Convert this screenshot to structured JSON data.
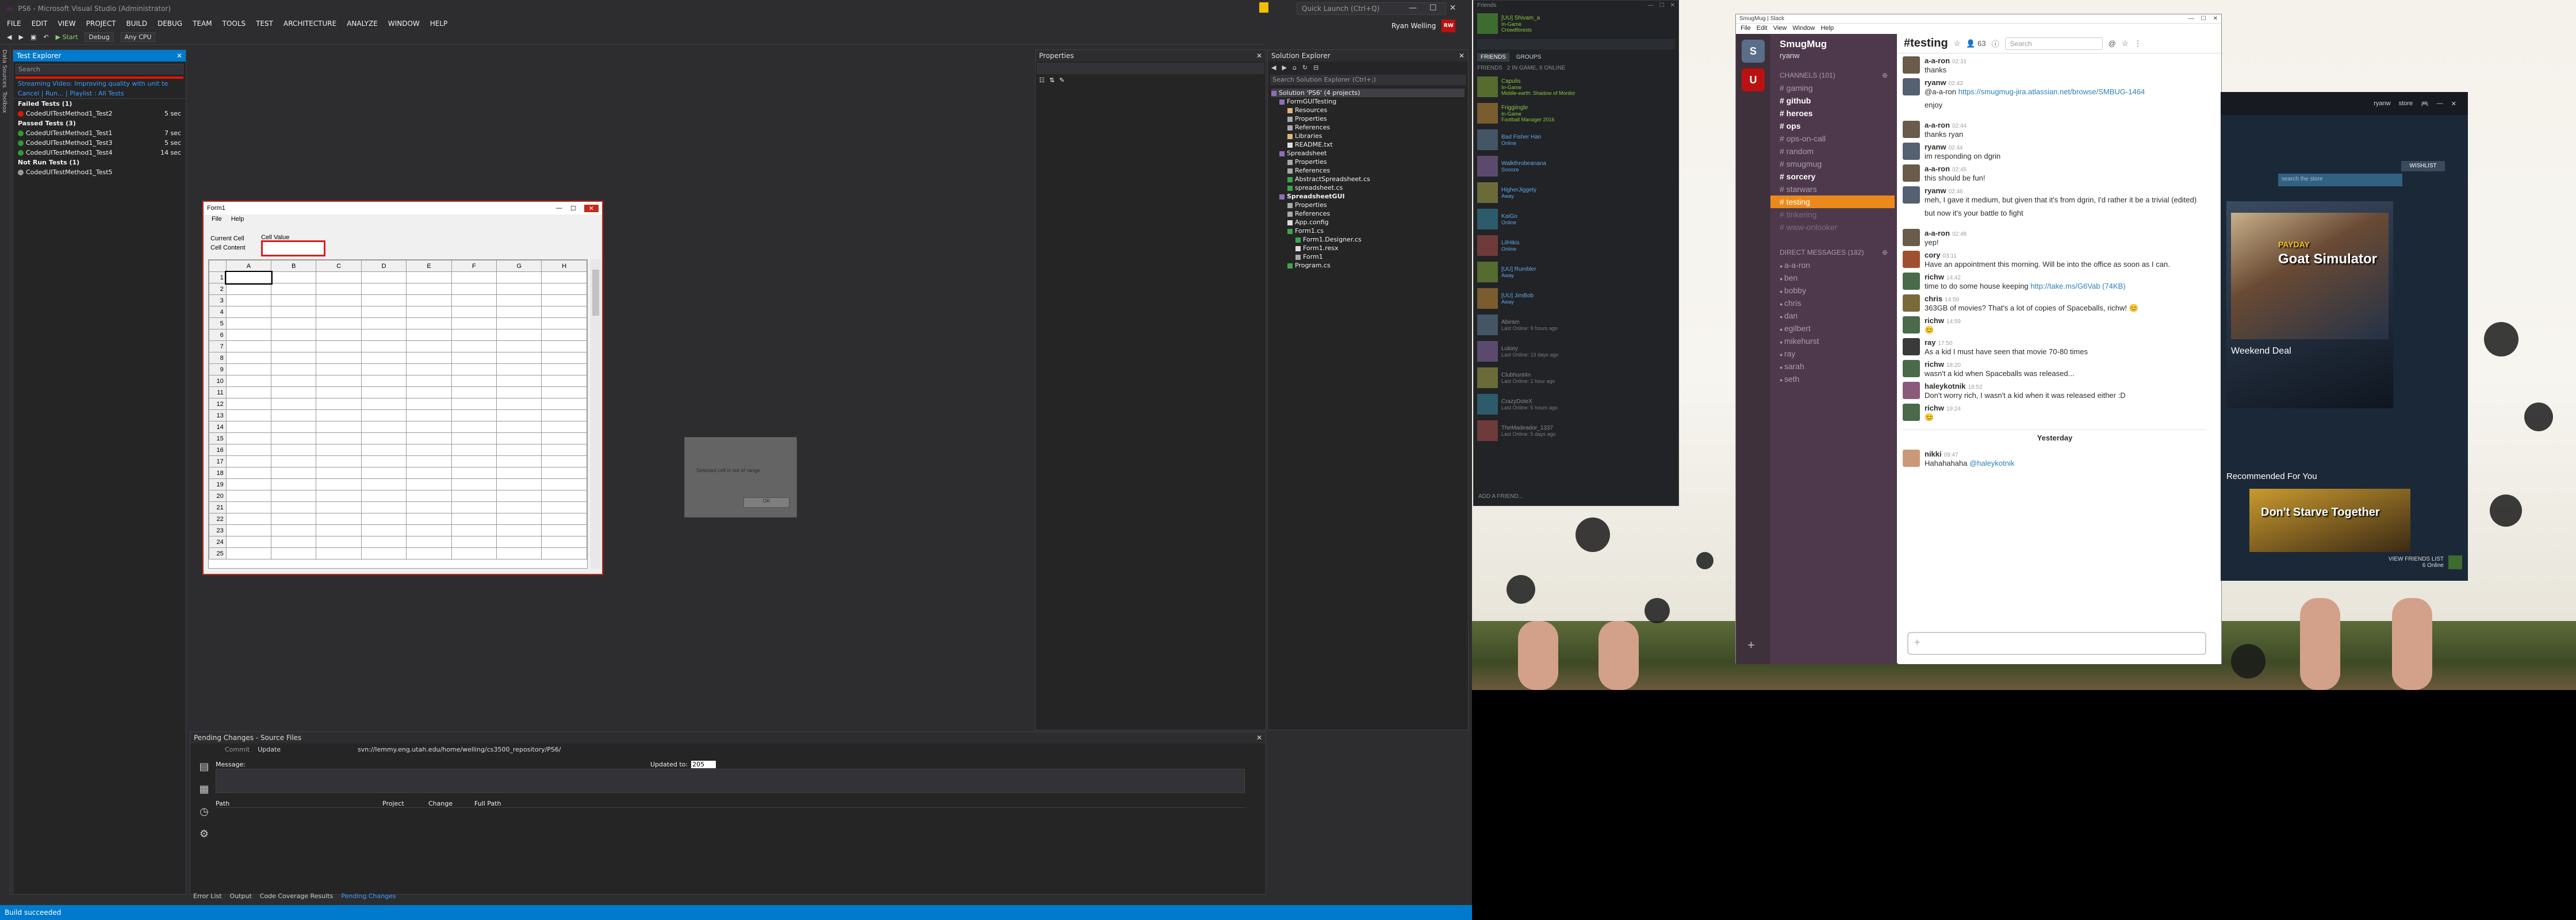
{
  "vs": {
    "title": "PS6 - Microsoft Visual Studio (Administrator)",
    "quick_launch": "Quick Launch (Ctrl+Q)",
    "user": "Ryan Welling",
    "user_initials": "RW",
    "menu": [
      "FILE",
      "EDIT",
      "VIEW",
      "PROJECT",
      "BUILD",
      "DEBUG",
      "TEAM",
      "TOOLS",
      "TEST",
      "ARCHITECTURE",
      "ANALYZE",
      "WINDOW",
      "HELP"
    ],
    "toolbar": {
      "start": "Start",
      "config": "Debug",
      "platform": "Any CPU"
    },
    "left_strip": [
      "Data Sources",
      "Toolbox"
    ],
    "test_explorer": {
      "title": "Test Explorer",
      "search": "Search",
      "warning": "Streaming Video: Improving quality with unit te",
      "links": "Cancel | Run... | Playlist : All Tests",
      "groups": [
        {
          "label": "Failed Tests (1)",
          "color": "#e51400",
          "tests": [
            {
              "name": "CodedUITestMethod1_Test2",
              "time": "5 sec"
            }
          ]
        },
        {
          "label": "Passed Tests (3)",
          "color": "#339933",
          "tests": [
            {
              "name": "CodedUITestMethod1_Test1",
              "time": "7 sec"
            },
            {
              "name": "CodedUITestMethod1_Test3",
              "time": "5 sec"
            },
            {
              "name": "CodedUITestMethod1_Test4",
              "time": "14 sec"
            }
          ]
        },
        {
          "label": "Not Run Tests (1)",
          "color": "#999999",
          "tests": [
            {
              "name": "CodedUITestMethod1_Test5",
              "time": ""
            }
          ]
        }
      ]
    },
    "form": {
      "title": "Form1",
      "menu": [
        "File",
        "Help"
      ],
      "current_cell_label": "Current Cell",
      "cell_value_label": "Cell Value",
      "cell_content_label": "Cell Content",
      "columns": [
        "A",
        "B",
        "C",
        "D",
        "E",
        "F",
        "G",
        "H"
      ],
      "rows": [
        "1",
        "2",
        "3",
        "4",
        "5",
        "6",
        "7",
        "8",
        "9",
        "10",
        "11",
        "12",
        "13",
        "14",
        "15",
        "16",
        "17",
        "18",
        "19",
        "20",
        "21",
        "22",
        "23",
        "24",
        "25"
      ]
    },
    "ghost_dialog": {
      "text": "Selected cell is out of range.",
      "button": "OK"
    },
    "properties": {
      "title": "Properties"
    },
    "solution_explorer": {
      "title": "Solution Explorer",
      "search": "Search Solution Explorer (Ctrl+;)",
      "items": [
        "Solution 'PS6' (4 projects)",
        "FormGUITesting",
        "Resources",
        "Properties",
        "References",
        "Libraries",
        "README.txt",
        "Spreadsheet",
        "Properties",
        "References",
        "AbstractSpreadsheet.cs",
        "spreadsheet.cs",
        "SpreadsheetGUI",
        "Properties",
        "References",
        "App.config",
        "Form1.cs",
        "Form1.Designer.cs",
        "Form1.resx",
        "Form1",
        "Program.cs"
      ]
    },
    "pending": {
      "title": "Pending Changes - Source Files",
      "actions": [
        "Commit",
        "Update"
      ],
      "path": "svn://lemmy.eng.utah.edu/home/welling/cs3500_repository/PS6/",
      "message_label": "Message:",
      "updated_label": "Updated to:",
      "updated_value": "205",
      "columns": [
        "Path",
        "Project",
        "Change",
        "Full Path"
      ],
      "tabs": [
        "Error List",
        "Output",
        "Code Coverage Results",
        "Pending Changes"
      ]
    },
    "status": "Build succeeded"
  },
  "steam": {
    "header": "Friends",
    "me": {
      "name": "[UU] Shivam_a",
      "status": "In-Game",
      "game": "Crowdforests"
    },
    "tabs": [
      "FRIENDS",
      "GROUPS"
    ],
    "section": "FRIENDS",
    "online": "2 IN GAME, 6 ONLINE",
    "friends": [
      {
        "name": "Capulis",
        "status": "In-Game",
        "sub": "Middle-earth: Shadow of Mordor",
        "state": "ingame"
      },
      {
        "name": "Friggiingle",
        "status": "In-Game",
        "sub": "Football Manager 2016",
        "state": "ingame"
      },
      {
        "name": "Bad Fisher Han",
        "status": "Online",
        "sub": "",
        "state": "online"
      },
      {
        "name": "Walkthrobeanana",
        "status": "Snooze",
        "sub": "",
        "state": "online"
      },
      {
        "name": "HigherJiggety",
        "status": "Away",
        "sub": "",
        "state": "online"
      },
      {
        "name": "KaiGo",
        "status": "Online",
        "sub": "",
        "state": "online"
      },
      {
        "name": "LilHikis",
        "status": "Online",
        "sub": "",
        "state": "online"
      },
      {
        "name": "[UU] Rumbler",
        "status": "Away",
        "sub": "",
        "state": "online"
      },
      {
        "name": "[UU] JimBob",
        "status": "Away",
        "sub": "",
        "state": "online"
      },
      {
        "name": "Abiram",
        "status": "Last Online: 9 hours ago",
        "sub": "",
        "state": "off"
      },
      {
        "name": "Lukiey",
        "status": "Last Online: 13 days ago",
        "sub": "",
        "state": "off"
      },
      {
        "name": "Clubhunt4n",
        "status": "Last Online: 1 hour ago",
        "sub": "",
        "state": "off"
      },
      {
        "name": "CrazyDoteX",
        "status": "Last Online: 5 hours ago",
        "sub": "",
        "state": "off"
      },
      {
        "name": "TheMadeador_1337",
        "status": "Last Online: 5 days ago",
        "sub": "",
        "state": "off"
      }
    ],
    "add": "ADD A FRIEND..."
  },
  "slack": {
    "window_title": "SmugMug | Slack",
    "menu": [
      "File",
      "Edit",
      "View",
      "Window",
      "Help"
    ],
    "team": "SmugMug",
    "me": "ryanw",
    "channels_label": "CHANNELS (101)",
    "channels": [
      {
        "name": "# gaming",
        "style": ""
      },
      {
        "name": "# github",
        "style": "bold"
      },
      {
        "name": "# heroes",
        "style": "bold"
      },
      {
        "name": "# ops",
        "style": "bold"
      },
      {
        "name": "# ops-on-call",
        "style": ""
      },
      {
        "name": "# random",
        "style": ""
      },
      {
        "name": "# smugmug",
        "style": ""
      },
      {
        "name": "# sorcery",
        "style": "bold"
      },
      {
        "name": "# starwars",
        "style": ""
      },
      {
        "name": "# testing",
        "style": "sel"
      },
      {
        "name": "# tinkering",
        "style": "faded"
      },
      {
        "name": "# www-onlooker",
        "style": "faded"
      }
    ],
    "dm_label": "DIRECT MESSAGES (182)",
    "dms": [
      "a-a-ron",
      "ben",
      "bobby",
      "chris",
      "dan",
      "egilbert",
      "mikehurst",
      "ray",
      "sarah",
      "seth"
    ],
    "channel": "testing",
    "members": "63",
    "search": "Search",
    "messages": [
      {
        "who": "a-a-ron",
        "ts": "02:31",
        "lines": [
          "thanks"
        ],
        "link": ""
      },
      {
        "who": "ryanw",
        "ts": "02:43",
        "lines": [
          "@a-a-ron"
        ],
        "link": "https://smugmug-jira.atlassian.net/browse/SMBUG-1464"
      },
      {
        "who": "",
        "ts": "",
        "lines": [
          "enjoy"
        ],
        "link": ""
      },
      {
        "who": "a-a-ron",
        "ts": "02:44",
        "lines": [
          "thanks ryan"
        ],
        "link": ""
      },
      {
        "who": "ryanw",
        "ts": "02:44",
        "lines": [
          "im responding on dgrin"
        ],
        "link": ""
      },
      {
        "who": "a-a-ron",
        "ts": "02:45",
        "lines": [
          "this should be fun!"
        ],
        "link": ""
      },
      {
        "who": "ryanw",
        "ts": "02:46",
        "lines": [
          "meh, I gave it medium, but given that it's from dgrin, I'd rather it be a trivial (edited)"
        ],
        "link": ""
      },
      {
        "who": "",
        "ts": "",
        "lines": [
          "but now it's your battle to fight"
        ],
        "link": ""
      },
      {
        "who": "a-a-ron",
        "ts": "02:48",
        "lines": [
          "yep!"
        ],
        "link": ""
      },
      {
        "who": "cory",
        "ts": "03:11",
        "lines": [
          "Have an appointment this morning.  Will be into the office as soon as I can."
        ],
        "link": ""
      },
      {
        "who": "richw",
        "ts": "14:42",
        "lines": [
          "time to do some house keeping"
        ],
        "link": "http://take.ms/G6Vab (74KB)"
      },
      {
        "who": "chris",
        "ts": "14:59",
        "lines": [
          "363GB of movies? That's a lot of copies of Spaceballs, richw! 😊"
        ],
        "link": ""
      },
      {
        "who": "richw",
        "ts": "14:59",
        "lines": [
          "😊"
        ],
        "link": ""
      },
      {
        "who": "ray",
        "ts": "17:50",
        "lines": [
          "As a kid I must have seen that movie 70-80 times"
        ],
        "link": ""
      },
      {
        "who": "richw",
        "ts": "18:20",
        "lines": [
          "wasn't a kid when Spaceballs was released..."
        ],
        "link": ""
      },
      {
        "who": "haleykotnik",
        "ts": "18:52",
        "lines": [
          "Don't worry rich, I wasn't a kid when it was released either :D"
        ],
        "link": ""
      },
      {
        "who": "richw",
        "ts": "19:24",
        "lines": [
          "😊"
        ],
        "link": ""
      }
    ],
    "day_divider": "Yesterday",
    "last_message": {
      "who": "nikki",
      "ts": "09:47",
      "text": "Hahahahaha",
      "mention": "@haleykotnik"
    }
  },
  "store": {
    "top": [
      "ryanw",
      "store"
    ],
    "wishlist": "WISHLIST",
    "search": "search the store",
    "game_title": "Goat Simulator",
    "game_sub": "PAYDAY",
    "deal": "Weekend Deal",
    "recommended": "Recommended For You",
    "rec_game": "Don't Starve Together",
    "friends_list": "VIEW FRIENDS LIST",
    "online_count": "6 Online"
  }
}
